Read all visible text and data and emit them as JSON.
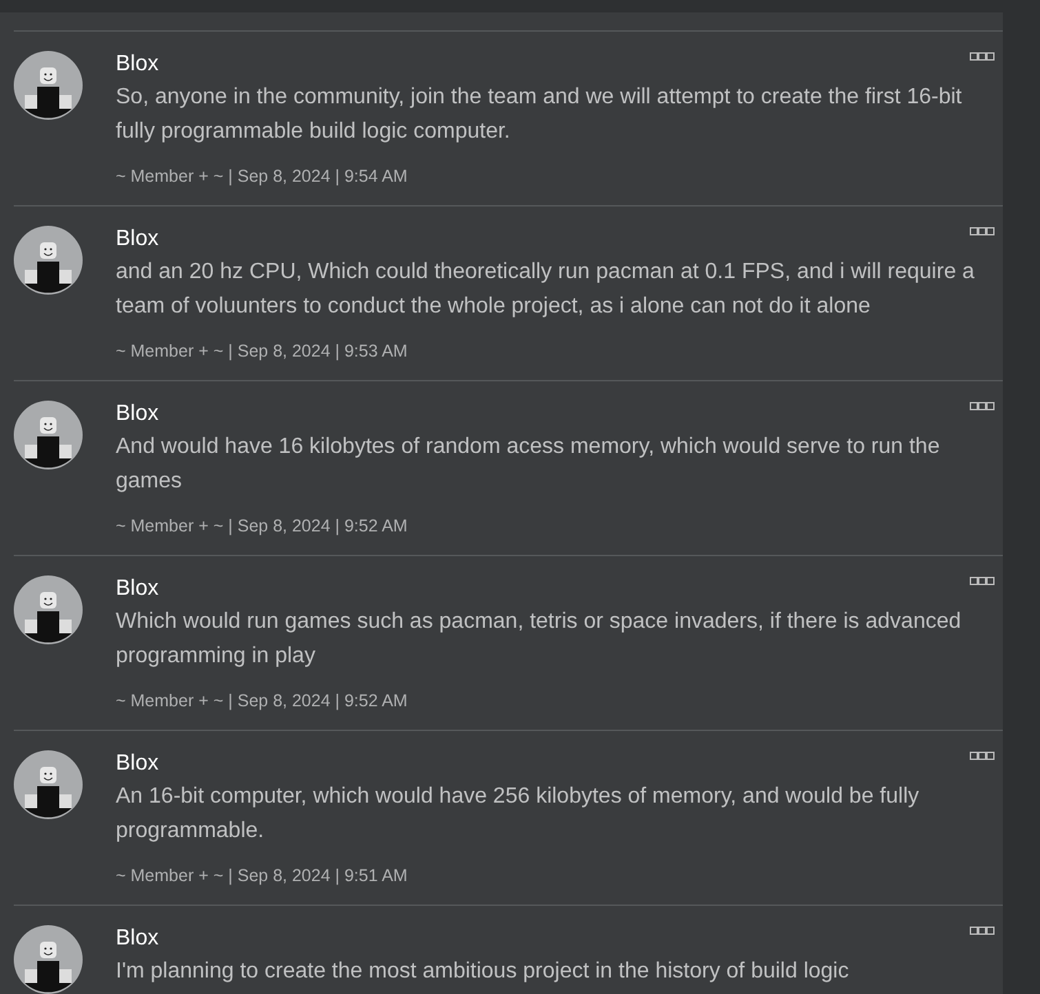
{
  "posts": [
    {
      "author": "Blox",
      "body": "So, anyone in the community, join the team and we will attempt to create the first 16-bit fully programmable build logic computer.",
      "meta": "~ Member + ~ | Sep 8, 2024 | 9:54 AM"
    },
    {
      "author": "Blox",
      "body": "and an 20 hz CPU, Which could theoretically run pacman at 0.1 FPS, and i will require a team of voluunters to conduct the whole project, as i alone can not do it alone",
      "meta": "~ Member + ~ | Sep 8, 2024 | 9:53 AM"
    },
    {
      "author": "Blox",
      "body": "And would have 16 kilobytes of random acess memory, which would serve to run the games",
      "meta": "~ Member + ~ | Sep 8, 2024 | 9:52 AM"
    },
    {
      "author": "Blox",
      "body": "Which would run games such as pacman, tetris or space invaders, if there is advanced programming in play",
      "meta": "~ Member + ~ | Sep 8, 2024 | 9:52 AM"
    },
    {
      "author": "Blox",
      "body": "An 16-bit computer, which would have 256 kilobytes of memory, and would be fully programmable.",
      "meta": "~ Member + ~ | Sep 8, 2024 | 9:51 AM"
    },
    {
      "author": "Blox",
      "body": "I'm planning to create the most ambitious project in the history of build logic"
    }
  ]
}
